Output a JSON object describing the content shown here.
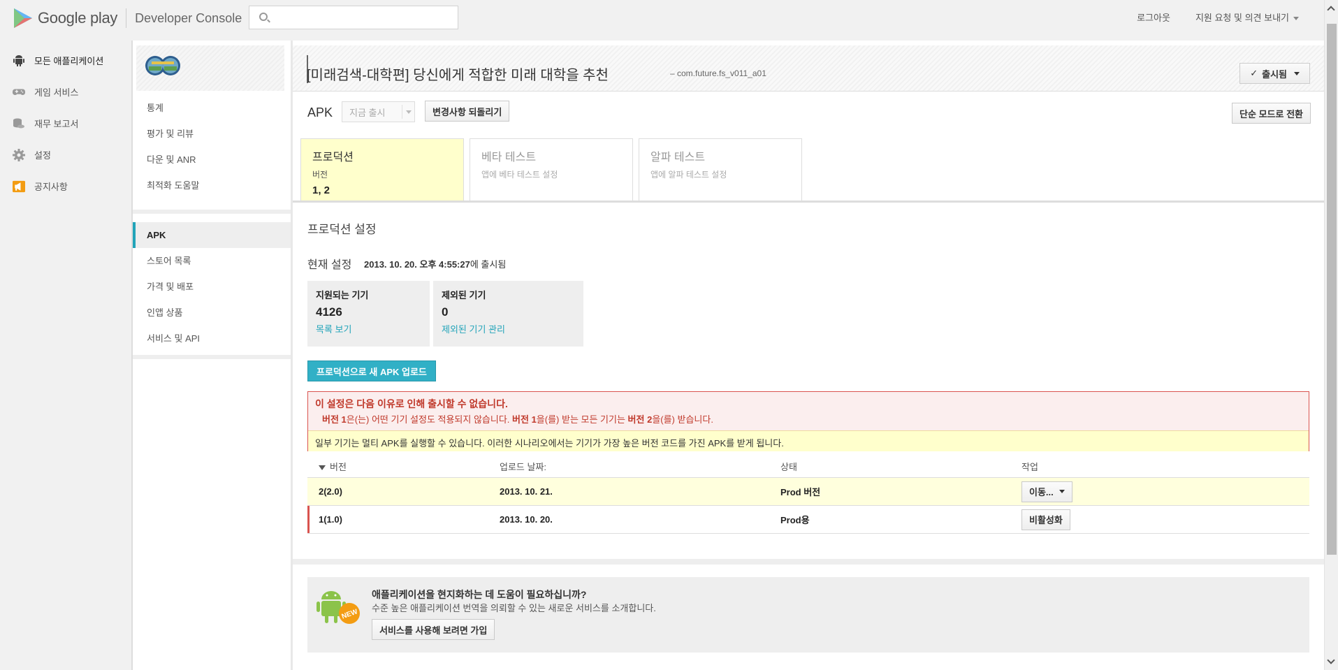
{
  "header": {
    "brand": "Google play",
    "console": "Developer Console",
    "search_placeholder": "",
    "logout": "로그아웃",
    "support": "지원 요청 및 의견 보내기"
  },
  "leftnav": {
    "items": [
      {
        "label": "모든 애플리케이션",
        "icon": "android-icon"
      },
      {
        "label": "게임 서비스",
        "icon": "gamepad-icon"
      },
      {
        "label": "재무 보고서",
        "icon": "coins-icon"
      },
      {
        "label": "설정",
        "icon": "gear-icon"
      },
      {
        "label": "공지사항",
        "icon": "megaphone-icon"
      }
    ]
  },
  "appnav": {
    "group1": [
      "통계",
      "평가 및 리뷰",
      "다운 및 ANR",
      "최적화 도움말"
    ],
    "group2": [
      "APK",
      "스토어 목록",
      "가격 및 배포",
      "인앱 상품",
      "서비스 및 API"
    ],
    "active": "APK"
  },
  "app": {
    "title": "[미래검색-대학편] 당신에게 적합한 미래 대학을 추천",
    "package": "– com.future.fs_v011_a01",
    "status_button": "출시됨"
  },
  "apk": {
    "label": "APK",
    "publish_now": "지금 출시",
    "revert": "변경사항 되돌리기",
    "simple_mode": "단순 모드로 전환"
  },
  "tabs": [
    {
      "title": "프로덕션",
      "sub": "버전",
      "value": "1, 2"
    },
    {
      "title": "베타 테스트",
      "sub": "앱에 베타 테스트 설정",
      "value": ""
    },
    {
      "title": "알파 테스트",
      "sub": "앱에 알파 테스트 설정",
      "value": ""
    }
  ],
  "production": {
    "heading": "프로덕션 설정",
    "current_label": "현재 설정",
    "current_date": "2013. 10. 20. 오후 4:55:27",
    "current_suffix": "에 출시됨",
    "supported": {
      "label": "지원되는 기기",
      "value": "4126",
      "link": "목록 보기"
    },
    "excluded": {
      "label": "제외된 기기",
      "value": "0",
      "link": "제외된 기기 관리"
    },
    "upload_button": "프로덕션으로 새 APK 업로드"
  },
  "error": {
    "title": "이 설정은 다음 이유로 인해 출시할 수 없습니다.",
    "d1": "버전 1",
    "d2": "은(는) 어떤 기기 설정도 적용되지 않습니다. ",
    "d3": "버전 1",
    "d4": "을(를) 받는 모든 기기는 ",
    "d5": "버전 2",
    "d6": "을(를) 받습니다.",
    "warning": "일부 기기는 멀티 APK를 실행할 수 있습니다. 이러한 시나리오에서는 기기가 가장 높은 버전 코드를 가진 APK를 받게 됩니다."
  },
  "versions": {
    "headers": [
      "버전",
      "업로드 날짜:",
      "상태",
      "작업"
    ],
    "rows": [
      {
        "version": "2(2.0)",
        "date": "2013. 10. 21.",
        "status": "Prod 버전",
        "action": "이동..."
      },
      {
        "version": "1(1.0)",
        "date": "2013. 10. 20.",
        "status": "Prod용",
        "action": "비활성화"
      }
    ]
  },
  "promo": {
    "badge": "NEW",
    "title": "애플리케이션을 현지화하는 데 도움이 필요하십니까?",
    "subtitle": "수준 높은 애플리케이션 번역을 의뢰할 수 있는 새로운 서비스를 소개합니다.",
    "button": "서비스를 사용해 보려면 가입"
  },
  "colors": {
    "accent": "#31b0c6",
    "error": "#c0392b",
    "highlight": "#ffffcc",
    "notice_orange": "#f39c12"
  }
}
